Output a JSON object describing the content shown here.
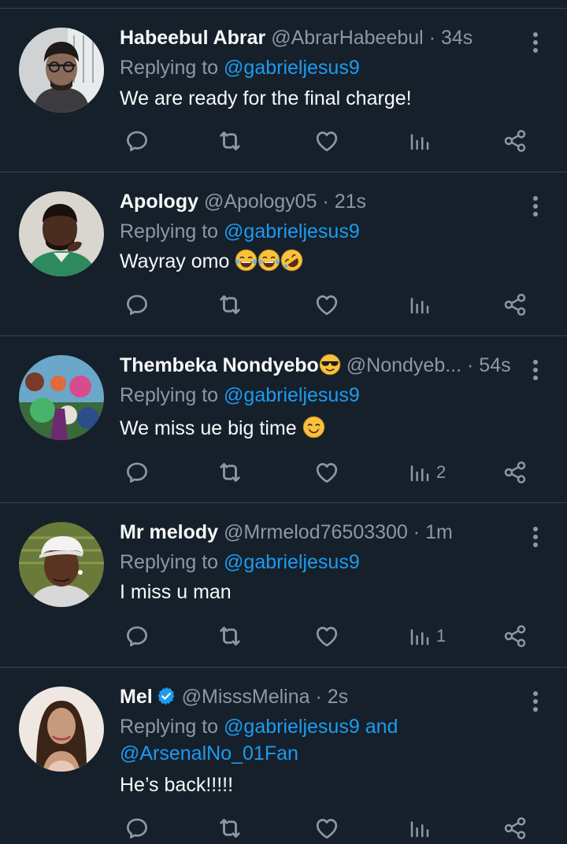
{
  "replying_label": "Replying to",
  "tweets": [
    {
      "name": "Habeebul Abrar",
      "handle": "@AbrarHabeebul",
      "time": "· 34s",
      "mentions": [
        "@gabrieljesus9"
      ],
      "text": "We are ready for the final charge!",
      "emojis": [],
      "views": ""
    },
    {
      "name": "Apology",
      "handle": "@Apology05",
      "time": "· 21s",
      "mentions": [
        "@gabrieljesus9"
      ],
      "text": "Wayray omo",
      "emojis": [
        "face-with-tears-of-joy",
        "face-with-tears-of-joy",
        "rolling-on-floor-laughing"
      ],
      "views": ""
    },
    {
      "name": "Thembeka Nondyebo",
      "name_emoji": "smiling-face-with-sunglasses",
      "handle": "@Nondyeb...",
      "time": "· 54s",
      "mentions": [
        "@gabrieljesus9"
      ],
      "text": "We miss ue big time",
      "emojis": [
        "smiling-face-with-smiling-eyes"
      ],
      "views": "2"
    },
    {
      "name": "Mr melody",
      "handle": "@Mrmelod76503300",
      "time": "· 1m",
      "mentions": [
        "@gabrieljesus9"
      ],
      "text": "I miss u man",
      "emojis": [],
      "views": "1"
    },
    {
      "name": "Mel",
      "verified": true,
      "handle": "@MisssMelina",
      "time": "· 2s",
      "mentions": [
        "@gabrieljesus9",
        "@ArsenalNo_01Fan"
      ],
      "mention_joiner": "and",
      "text": "He’s back!!!!!",
      "emojis": [],
      "views": ""
    }
  ],
  "colors": {
    "background": "#15202b",
    "divider": "#38444d",
    "primary_text": "#f7f9f9",
    "secondary_text": "#8b98a5",
    "link": "#1d9bf0",
    "verified": "#1d9bf0"
  },
  "icons": [
    "reply-icon",
    "retweet-icon",
    "like-icon",
    "views-icon",
    "share-icon",
    "more-icon",
    "verified-badge-icon"
  ]
}
